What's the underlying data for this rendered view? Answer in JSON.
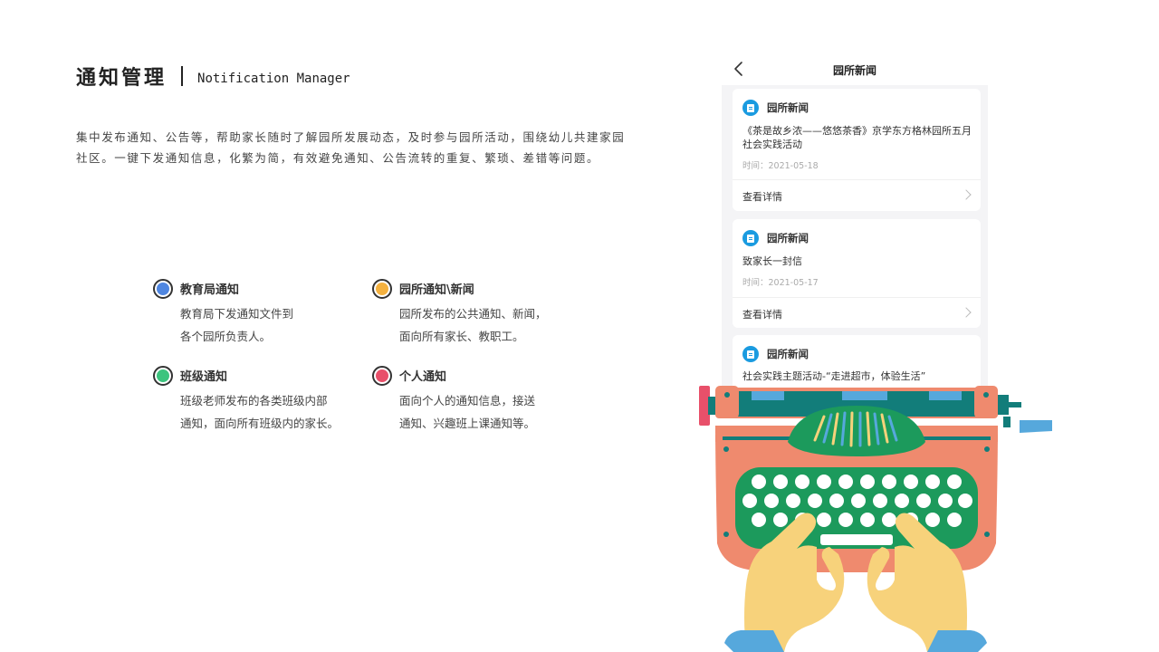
{
  "header": {
    "title_cn": "通知管理",
    "title_en": "Notification Manager"
  },
  "description": {
    "line1": "集中发布通知、公告等，帮助家长随时了解园所发展动态，及时参与园所活动，围绕幼儿共建家园",
    "line2": "社区。一键下发通知信息，化繁为简，有效避免通知、公告流转的重复、繁琐、差错等问题。"
  },
  "features": [
    {
      "title": "教育局通知",
      "desc1": "教育局下发通知文件到",
      "desc2": "各个园所负责人。",
      "color": "#4f86e0"
    },
    {
      "title": "园所通知\\新闻",
      "desc1": "园所发布的公共通知、新闻，",
      "desc2": "面向所有家长、教职工。",
      "color": "#f4b13f"
    },
    {
      "title": "班级通知",
      "desc1": "班级老师发布的各类班级内部",
      "desc2": "通知，面向所有班级内的家长。",
      "color": "#3cc47e"
    },
    {
      "title": "个人通知",
      "desc1": "面向个人的通知信息，接送",
      "desc2": "通知、兴趣班上课通知等。",
      "color": "#e8506a"
    }
  ],
  "phone": {
    "title": "园所新闻",
    "cards": [
      {
        "category": "园所新闻",
        "title": "《茶是故乡浓——悠悠茶香》京学东方格林园所五月社会实践活动",
        "time": "时间：2021-05-18",
        "more": "查看详情"
      },
      {
        "category": "园所新闻",
        "title": "致家长一封信",
        "time": "时间：2021-05-17",
        "more": "查看详情"
      },
      {
        "category": "园所新闻",
        "title": "社会实践主题活动-“走进超市，体验生活”",
        "time": "",
        "more": ""
      }
    ]
  },
  "colors": {
    "typewriter_body": "#ef8a6e",
    "typewriter_keys": "#1c9a5c",
    "hands": "#f7d27b",
    "teal": "#127d7a",
    "blue": "#56a8dc"
  }
}
